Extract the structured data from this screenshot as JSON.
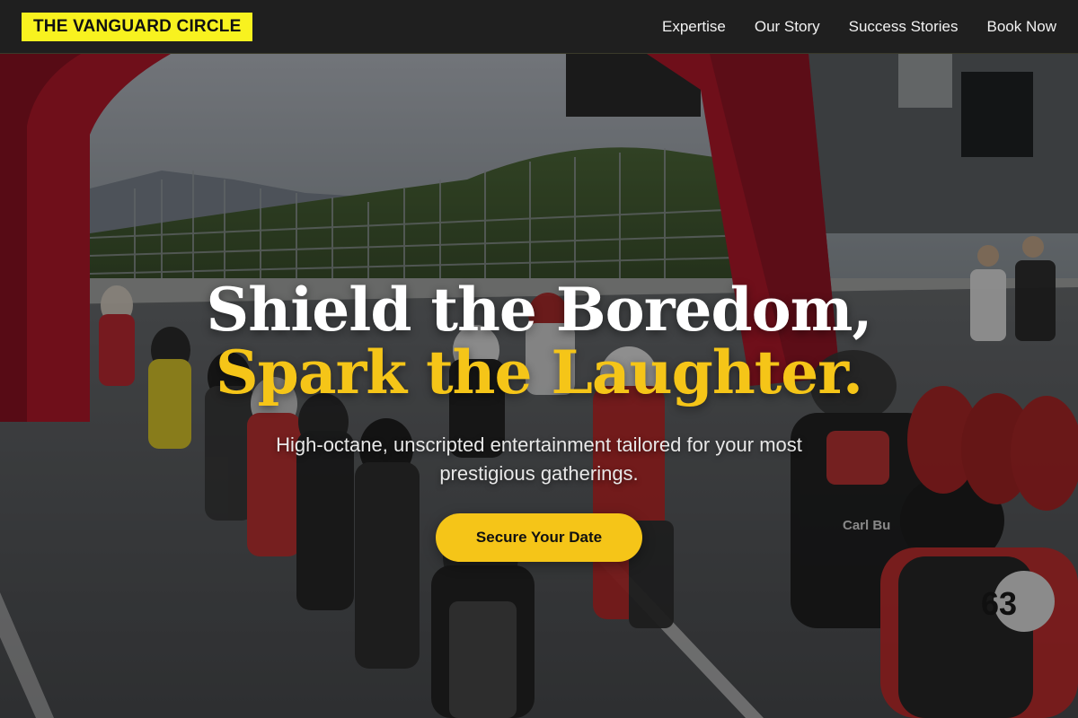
{
  "brand": {
    "logo_text": "THE VANGUARD CIRCLE",
    "accent_color": "#f8f21f"
  },
  "nav": {
    "items": [
      {
        "label": "Expertise"
      },
      {
        "label": "Our Story"
      },
      {
        "label": "Success Stories"
      },
      {
        "label": "Book Now"
      }
    ]
  },
  "hero": {
    "headline_part1": "Shield the Boredom, ",
    "headline_accent": "Spark the Laughter.",
    "subheadline": "High-octane, unscripted entertainment tailored for your most prestigious gatherings.",
    "cta_label": "Secure Your Date",
    "accent_color": "#f5c518",
    "rider_number": "63",
    "rider_name": "Carl Bu"
  }
}
